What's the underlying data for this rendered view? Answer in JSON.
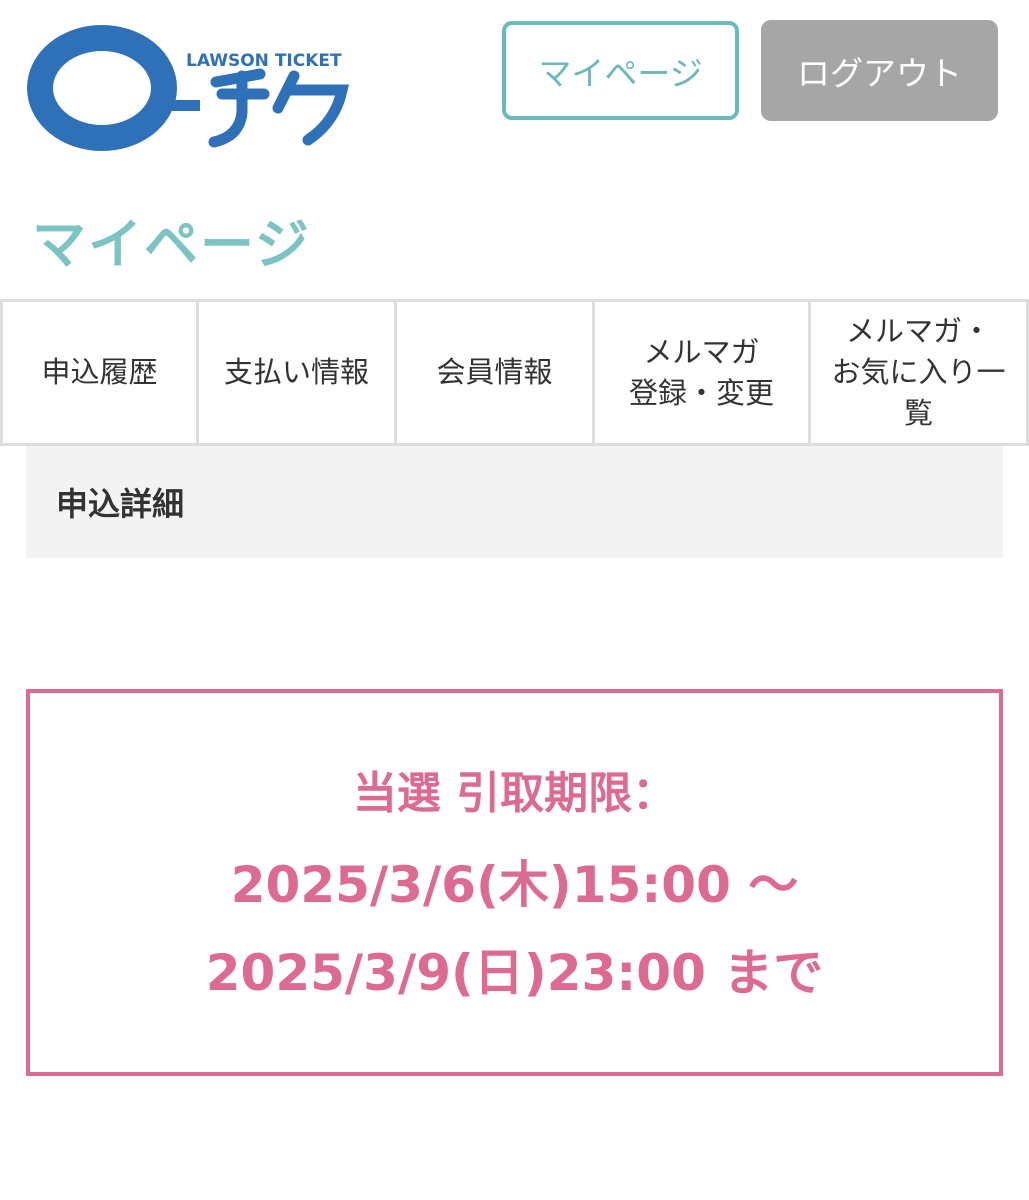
{
  "header": {
    "logo": {
      "wordmark": "LAWSON TICKET",
      "brand": "ローチケ",
      "primary_color": "#2f71b8"
    },
    "mypage_button": "マイページ",
    "logout_button": "ログアウト"
  },
  "page_title": "マイページ",
  "tabs": [
    {
      "lines": [
        "申込履歴"
      ]
    },
    {
      "lines": [
        "支払い情報"
      ]
    },
    {
      "lines": [
        "会員情報"
      ]
    },
    {
      "lines": [
        "メルマガ",
        "登録・変更"
      ]
    },
    {
      "lines": [
        "メルマガ・",
        "お気に入り一",
        "覧"
      ]
    }
  ],
  "section": {
    "label": "申込詳細"
  },
  "notice": {
    "line1": "当選 引取期限：",
    "line2": "2025/3/6(木)15:00 ～",
    "line3": "2025/3/9(日)23:00 まで",
    "color": "#dd6b91"
  },
  "colors": {
    "accent": "#69b9bd",
    "title": "#7cc3c4",
    "logout_bg": "#a6a6a6",
    "notice": "#dd6b91"
  }
}
